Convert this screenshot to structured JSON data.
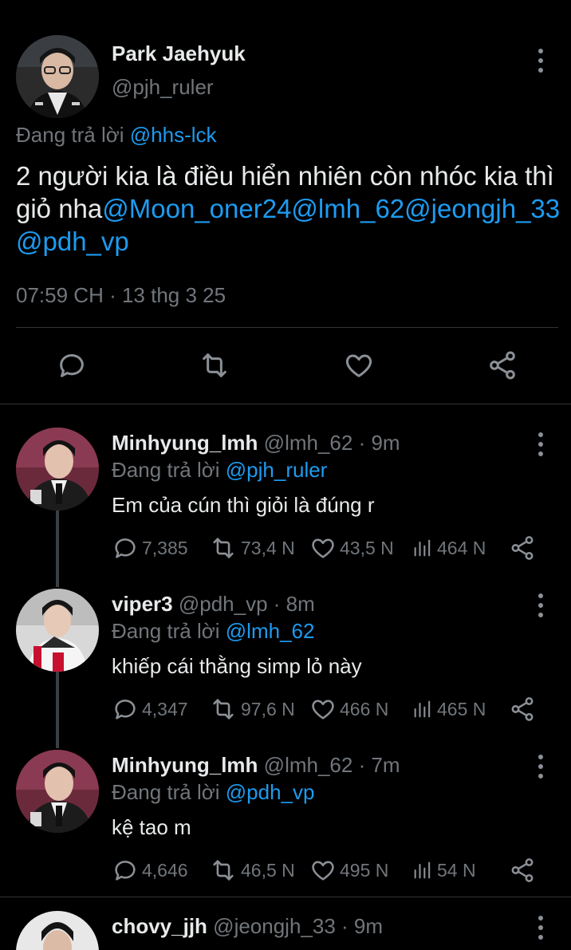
{
  "main": {
    "name": "Park Jaehyuk",
    "handle": "@pjh_ruler",
    "reply_prefix": "Đang trả lời ",
    "reply_to": "@hhs-lck",
    "text_plain": "2 người kia là điều hiển nhiên còn nhóc kia thì giỏ nha",
    "text_mentions": "@Moon_oner24@lmh_62@jeongjh_33@pdh_vp",
    "timestamp": "07:59 CH · 13 thg 3 25",
    "actions": [
      "reply-icon",
      "retweet-icon",
      "like-icon",
      "share-icon"
    ]
  },
  "replies": [
    {
      "name": "Minhyung_lmh",
      "handle": "@lmh_62 · 9m",
      "reply_prefix": "Đang trả lời ",
      "reply_to": "@pjh_ruler",
      "text": "Em của cún thì giỏi là đúng r",
      "replies_count": "7,385",
      "retweets": "73,4 N",
      "likes": "43,5 N",
      "views": "464 N"
    },
    {
      "name": "viper3",
      "handle": "@pdh_vp · 8m",
      "reply_prefix": "Đang trả lời ",
      "reply_to": "@lmh_62",
      "text": "khiếp cái thằng simp lỏ này",
      "replies_count": "4,347",
      "retweets": "97,6 N",
      "likes": "466 N",
      "views": "465 N"
    },
    {
      "name": "Minhyung_lmh",
      "handle": "@lmh_62 · 7m",
      "reply_prefix": "Đang trả lời ",
      "reply_to": "@pdh_vp",
      "text": "kệ tao m",
      "replies_count": "4,646",
      "retweets": "46,5 N",
      "likes": "495 N",
      "views": "54 N"
    },
    {
      "name": "chovy_jjh",
      "handle": "@jeongjh_33 · 9m"
    }
  ],
  "colors": {
    "background": "#000000",
    "text": "#e7e9ea",
    "secondary": "#71767b",
    "accent": "#1d9bf0",
    "divider": "#2f3336"
  }
}
